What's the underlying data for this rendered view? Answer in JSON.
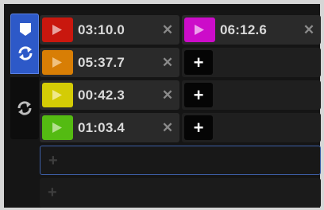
{
  "colors": {
    "red": "#c9170e",
    "magenta": "#cc0cc9",
    "orange": "#d87e05",
    "yellow": "#d4cc05",
    "green": "#54bb12",
    "active_blue": "#2d59c8"
  },
  "mode_rail": [
    {
      "name": "hotcue-loop-mode",
      "icons": [
        "flag-icon",
        "loop-icon"
      ],
      "active": true
    },
    {
      "name": "loop-mode",
      "icons": [
        "loop-icon"
      ],
      "active": false
    }
  ],
  "cues": [
    {
      "slot": 1,
      "time": "03:10.0",
      "color": "#c9170e",
      "remove": "✕"
    },
    {
      "slot": 2,
      "time": "05:37.7",
      "color": "#d87e05",
      "remove": "✕"
    },
    {
      "slot": 3,
      "time": "00:42.3",
      "color": "#d4cc05",
      "remove": "✕"
    },
    {
      "slot": 4,
      "time": "01:03.4",
      "color": "#54bb12",
      "remove": "✕"
    },
    {
      "slot": 5,
      "time": "06:12.6",
      "color": "#cc0cc9",
      "remove": "✕"
    }
  ],
  "empty_slots": [
    {
      "slot": 6,
      "label": "+"
    },
    {
      "slot": 7,
      "label": "+"
    },
    {
      "slot": 8,
      "label": "+"
    }
  ],
  "add_rows": [
    {
      "label": "+",
      "active": true
    },
    {
      "label": "+",
      "active": false
    }
  ]
}
